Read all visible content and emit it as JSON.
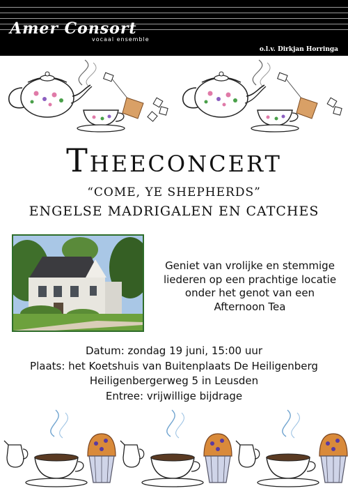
{
  "header": {
    "logo_text": "Amer Consort",
    "logo_subtitle": "vocaal ensemble",
    "conductor": "o.l.v. Dirkjan Horringa"
  },
  "title": "Theeconcert",
  "subtitle_line1": "“COME, YE SHEPHERDS”",
  "subtitle_line2": "ENGELSE MADRIGALEN EN CATCHES",
  "invitation": [
    "Geniet van vrolijke en stemmige",
    "liederen op een prachtige locatie",
    "onder het genot van een",
    "Afternoon Tea"
  ],
  "details": [
    "Datum: zondag 19 juni, 15:00 uur",
    "Plaats: het Koetshuis van Buitenplaats De Heiligenberg",
    "Heiligenbergerweg 5 in Leusden",
    "Entree: vrijwillige bijdrage"
  ],
  "icons": {
    "top_decoration": "teapot-teacup-icon",
    "bottom_decoration": "cup-muffin-icon",
    "photo": "coach-house-photo"
  },
  "colors": {
    "header_bg": "#000000",
    "photo_border": "#2e6d2a",
    "text": "#111111"
  }
}
